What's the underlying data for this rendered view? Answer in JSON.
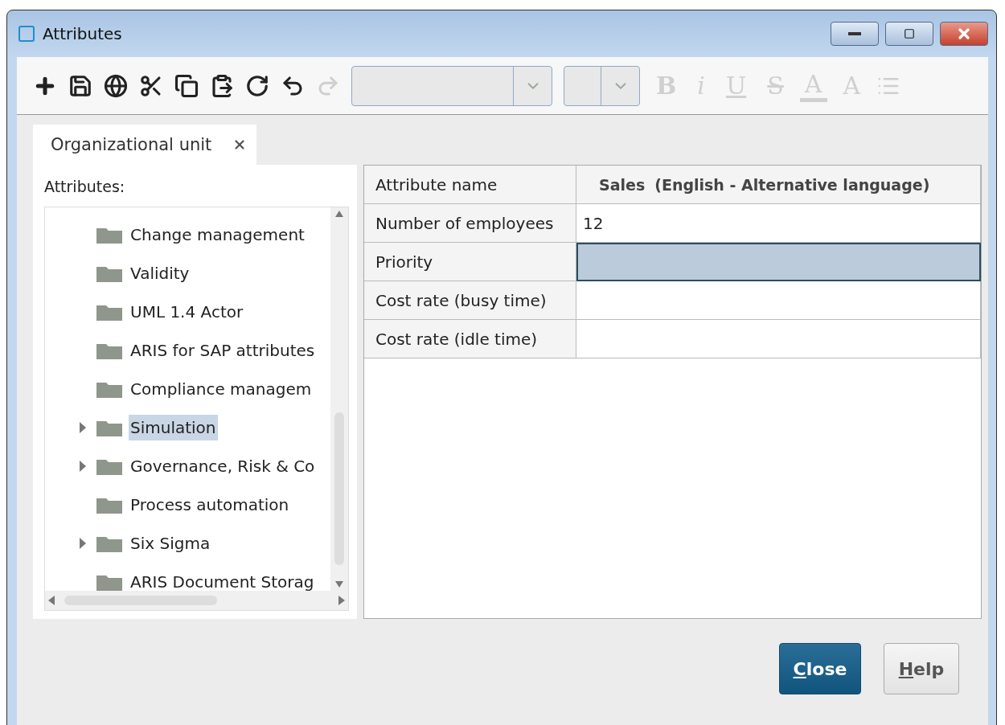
{
  "window": {
    "title": "Attributes"
  },
  "toolbar": {
    "actions": [
      {
        "kind": "add",
        "disabled": false
      },
      {
        "kind": "save",
        "disabled": false
      },
      {
        "kind": "globe",
        "disabled": false
      },
      {
        "kind": "cut",
        "disabled": false
      },
      {
        "kind": "copy",
        "disabled": false
      },
      {
        "kind": "paste",
        "disabled": false
      },
      {
        "kind": "refresh",
        "disabled": false
      },
      {
        "kind": "undo",
        "disabled": false
      },
      {
        "kind": "redo",
        "disabled": true
      }
    ],
    "format": [
      {
        "label": "B",
        "kind": "bold",
        "disabled": true
      },
      {
        "label": "i",
        "kind": "italic",
        "disabled": true
      },
      {
        "label": "U",
        "kind": "underline",
        "disabled": true
      },
      {
        "label": "S",
        "kind": "strike",
        "disabled": true
      },
      {
        "label": "A",
        "kind": "color",
        "disabled": true
      },
      {
        "label": "A",
        "kind": "clear",
        "disabled": true
      },
      {
        "kind": "list",
        "disabled": true
      }
    ]
  },
  "tabs": [
    {
      "label": "Organizational unit",
      "selected": true
    }
  ],
  "tree": {
    "label": "Attributes:",
    "items": [
      {
        "label": "Change management",
        "expandable": false,
        "selected": false
      },
      {
        "label": "Validity",
        "expandable": false,
        "selected": false
      },
      {
        "label": "UML 1.4 Actor",
        "expandable": false,
        "selected": false
      },
      {
        "label": "ARIS for SAP attributes",
        "expandable": false,
        "selected": false
      },
      {
        "label": "Compliance managem",
        "expandable": false,
        "selected": false
      },
      {
        "label": "Simulation",
        "expandable": true,
        "selected": true
      },
      {
        "label": "Governance, Risk & Co",
        "expandable": true,
        "selected": false
      },
      {
        "label": "Process automation",
        "expandable": false,
        "selected": false
      },
      {
        "label": "Six Sigma",
        "expandable": true,
        "selected": false
      },
      {
        "label": "ARIS Document Storag",
        "expandable": false,
        "selected": false
      }
    ]
  },
  "grid": {
    "header": {
      "name": "Attribute name",
      "value": "Sales",
      "language": "(English - Alternative language)"
    },
    "rows": [
      {
        "name": "Number of employees",
        "value": "12",
        "selected": false
      },
      {
        "name": "Priority",
        "selected": true
      },
      {
        "name": "Cost rate (busy time)",
        "selected": false
      },
      {
        "name": "Cost rate (idle time)",
        "selected": false
      }
    ]
  },
  "buttons": [
    {
      "label": "Close",
      "kind": "primary"
    },
    {
      "label": "Help",
      "kind": "secondary"
    }
  ]
}
